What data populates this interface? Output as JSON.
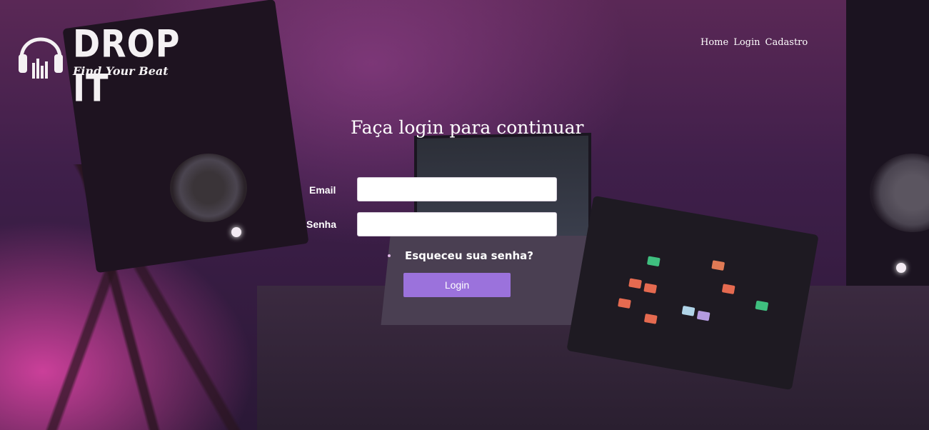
{
  "brand": {
    "title": "DROP IT",
    "tagline": "Find Your Beat"
  },
  "nav": {
    "items": [
      "Home",
      "Login",
      "Cadastro"
    ]
  },
  "form": {
    "heading": "Faça login para continuar",
    "email_label": "Email",
    "email_value": "",
    "password_label": "Senha",
    "password_value": "",
    "forgot_link": "Esqueceu sua senha?",
    "submit_label": "Login"
  },
  "colors": {
    "button": "#9b72dc",
    "text": "#ffffff"
  }
}
